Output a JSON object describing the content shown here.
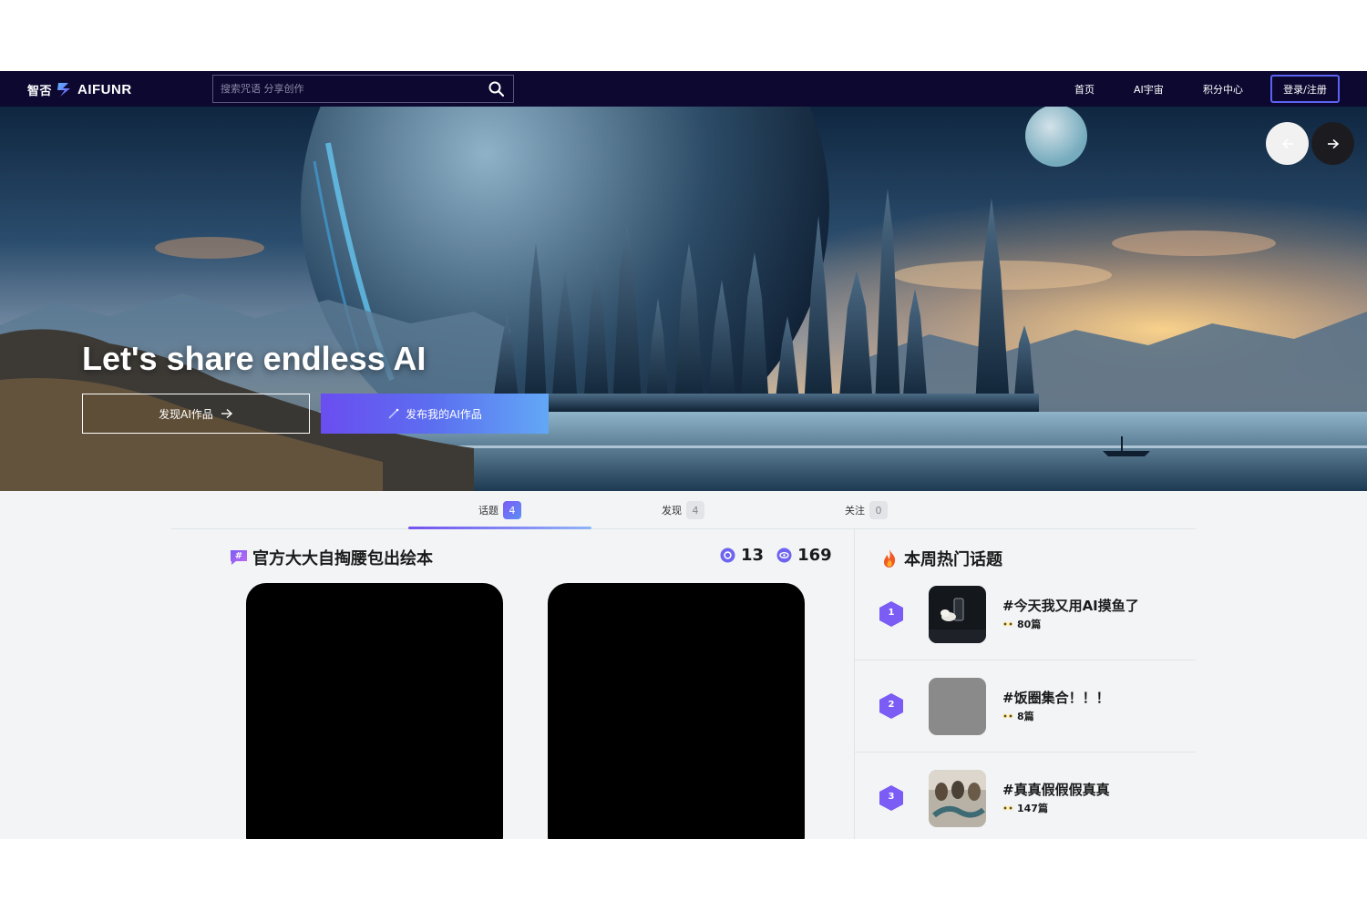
{
  "nav": {
    "logo_cn": "智否",
    "logo_en": "AIFUNR",
    "search_placeholder": "搜索咒语 分享创作",
    "links": [
      "首页",
      "AI宇宙",
      "积分中心"
    ],
    "login_label": "登录/注册"
  },
  "hero": {
    "title": "Let's share endless AI",
    "discover_label": "发现AI作品",
    "publish_label": "发布我的AI作品"
  },
  "tabs": [
    {
      "label": "话题",
      "count": "4",
      "active": true
    },
    {
      "label": "发现",
      "count": "4",
      "active": false
    },
    {
      "label": "关注",
      "count": "0",
      "active": false
    }
  ],
  "topic": {
    "title": "官方大大自掏腰包出绘本",
    "stat1": "13",
    "stat2": "169"
  },
  "hot": {
    "title": "本周热门话题",
    "items": [
      {
        "rank": "1",
        "name": "#今天我又用AI摸鱼了",
        "count": "80篇"
      },
      {
        "rank": "2",
        "name": "#饭圈集合！！！",
        "count": "8篇"
      },
      {
        "rank": "3",
        "name": "#真真假假假真真",
        "count": "147篇"
      }
    ]
  },
  "colors": {
    "nav_bg": "#0d0830",
    "accent": "#6a4df0",
    "rank_purple": "#7b5cf5"
  }
}
